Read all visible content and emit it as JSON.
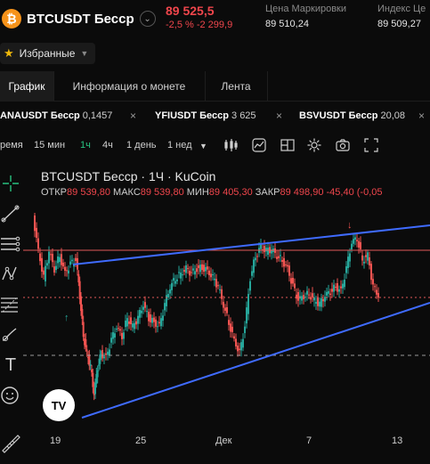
{
  "header": {
    "logo_glyph": "₿",
    "pair_name": "BTCUSDT Бесср",
    "caret_icon": "chevron-down-icon",
    "last_price": "89 525,5",
    "change": "-2,5 %  -2 299,9",
    "stats": [
      {
        "label": "Цена Маркировки",
        "value": "89 510,24"
      },
      {
        "label": "Индекс Це",
        "value": "89 509,27"
      }
    ]
  },
  "favorites": {
    "label": "Избранные"
  },
  "tabs": [
    {
      "label": "График",
      "active": true
    },
    {
      "label": "Информация о монете",
      "active": false
    },
    {
      "label": "Лента",
      "active": false
    }
  ],
  "ticker": [
    {
      "symbol": "ANAUSDT Бесср",
      "price": "0,1457"
    },
    {
      "symbol": "YFIUSDT Бесср",
      "price": "3 625"
    },
    {
      "symbol": "BSVUSDT Бесср",
      "price": "20,08"
    }
  ],
  "toolbar": {
    "time_label": "ремя",
    "intervals": [
      {
        "label": "15 мин",
        "active": false
      },
      {
        "label": "1ч",
        "active": true
      },
      {
        "label": "4ч",
        "active": false
      },
      {
        "label": "1 день",
        "active": false
      },
      {
        "label": "1 нед",
        "active": false
      }
    ],
    "dropdown_icon": "caret-down-icon"
  },
  "chart": {
    "title": "BTCUSDT Бесср · 1Ч · KuCoin",
    "ohlc": [
      {
        "k": "ОТКР",
        "v": "89 539,80"
      },
      {
        "k": "МАКС",
        "v": "89 539,80"
      },
      {
        "k": "МИН",
        "v": "89 405,30"
      },
      {
        "k": "ЗАКР",
        "v": "89 498,90"
      },
      {
        "k": "",
        "v": "-45,40 (-0,05"
      }
    ],
    "x_labels": [
      "19",
      "25",
      "Дек",
      "7",
      "13"
    ],
    "logo_text": "TV",
    "colors": {
      "up": "#26a69a",
      "down": "#ef5350",
      "trend": "#3f6bff",
      "hline": "#e05a5a"
    }
  }
}
